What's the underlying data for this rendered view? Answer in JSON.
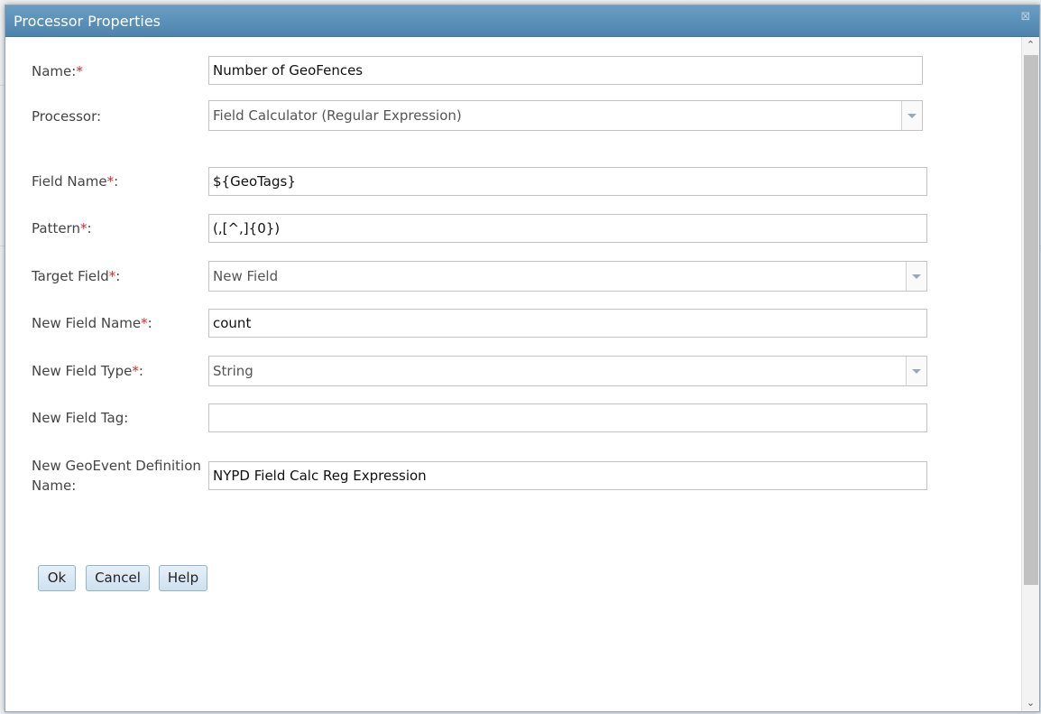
{
  "dialog": {
    "title": "Processor Properties",
    "close_glyph": "⊠"
  },
  "form": {
    "name": {
      "label": "Name:",
      "required": "*",
      "value": "Number of GeoFences"
    },
    "processor": {
      "label": "Processor:",
      "value": "Field Calculator (Regular Expression)"
    },
    "field_name": {
      "label": "Field Name",
      "required": "*",
      "colon": ":",
      "value": "${GeoTags}"
    },
    "pattern": {
      "label": "Pattern",
      "required": "*",
      "colon": ":",
      "value": "(,[^,]{0})"
    },
    "target_field": {
      "label": "Target Field",
      "required": "*",
      "colon": ":",
      "value": "New Field"
    },
    "new_field_name": {
      "label": "New Field Name",
      "required": "*",
      "colon": ":",
      "value": "count"
    },
    "new_field_type": {
      "label": "New Field Type",
      "required": "*",
      "colon": ":",
      "value": "String"
    },
    "new_field_tag": {
      "label": "New Field Tag:",
      "value": ""
    },
    "geoevent_def_name": {
      "label_line1": "New GeoEvent Definition",
      "label_line2": "Name:",
      "value": "NYPD Field Calc Reg Expression"
    }
  },
  "buttons": {
    "ok": "Ok",
    "cancel": "Cancel",
    "help": "Help"
  },
  "scrollbar": {
    "up": "⌃",
    "down": "⌄"
  },
  "colors": {
    "titlebar": "#5a8fb8",
    "required": "#e0262a",
    "button": "#d8e7f3"
  }
}
